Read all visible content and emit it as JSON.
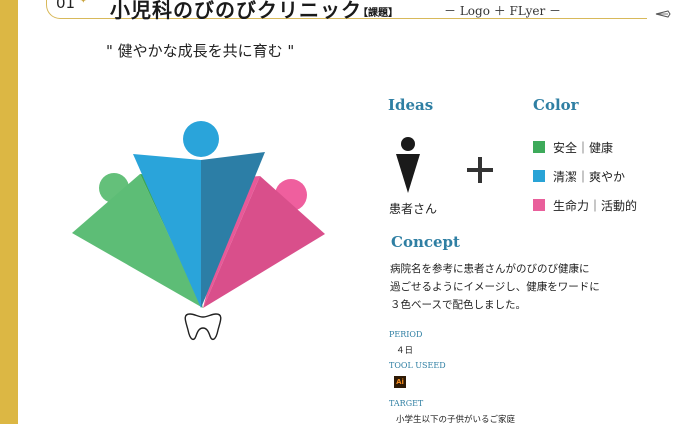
{
  "header": {
    "page_number": "01",
    "title": "小児科のびのびクリニック",
    "title_tag": "【課題】",
    "subtitle": "－ Logo ＋ FLyer －"
  },
  "tagline": "\" 健やかな成長を共に育む \"",
  "ideas": {
    "title": "Ideas",
    "label": "患者さん"
  },
  "color": {
    "title": "Color",
    "items": [
      {
        "label": "安全｜健康",
        "hex": "#3daa5a"
      },
      {
        "label": "清潔｜爽やか",
        "hex": "#29a3d6"
      },
      {
        "label": "生命力｜活動的",
        "hex": "#e95f9b"
      }
    ]
  },
  "concept": {
    "title": "Concept",
    "lines": [
      "病院名を参考に患者さんがのびのび健康に",
      "過ごせるようにイメージし、健康をワードに",
      "３色ベースで配色しました。"
    ]
  },
  "period": {
    "label": "PERIOD",
    "value": "４日"
  },
  "tool": {
    "label": "TOOL USEED",
    "icon_text": "Ai"
  },
  "target": {
    "label": "TARGET",
    "value": "小学生以下の子供がいるご家庭"
  }
}
